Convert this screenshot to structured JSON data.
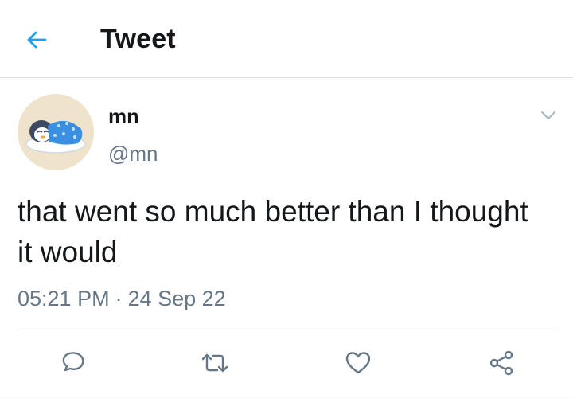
{
  "header": {
    "title": "Tweet",
    "back_icon": "arrow-left-icon",
    "accent": "#1da1f2"
  },
  "tweet": {
    "author": {
      "display_name": "mn",
      "handle": "@mn",
      "avatar": "penguin-in-blanket-avatar"
    },
    "text": "that went so much better than I thought it would",
    "time": "05:21 PM",
    "separator": "·",
    "date": "24 Sep 22"
  },
  "actions": [
    {
      "name": "reply",
      "icon": "reply-icon"
    },
    {
      "name": "retweet",
      "icon": "retweet-icon"
    },
    {
      "name": "like",
      "icon": "heart-icon"
    },
    {
      "name": "share",
      "icon": "share-icon"
    }
  ],
  "colors": {
    "text": "#14171a",
    "secondary": "#657786",
    "border": "#dfe3e7",
    "icon": "#657786"
  }
}
